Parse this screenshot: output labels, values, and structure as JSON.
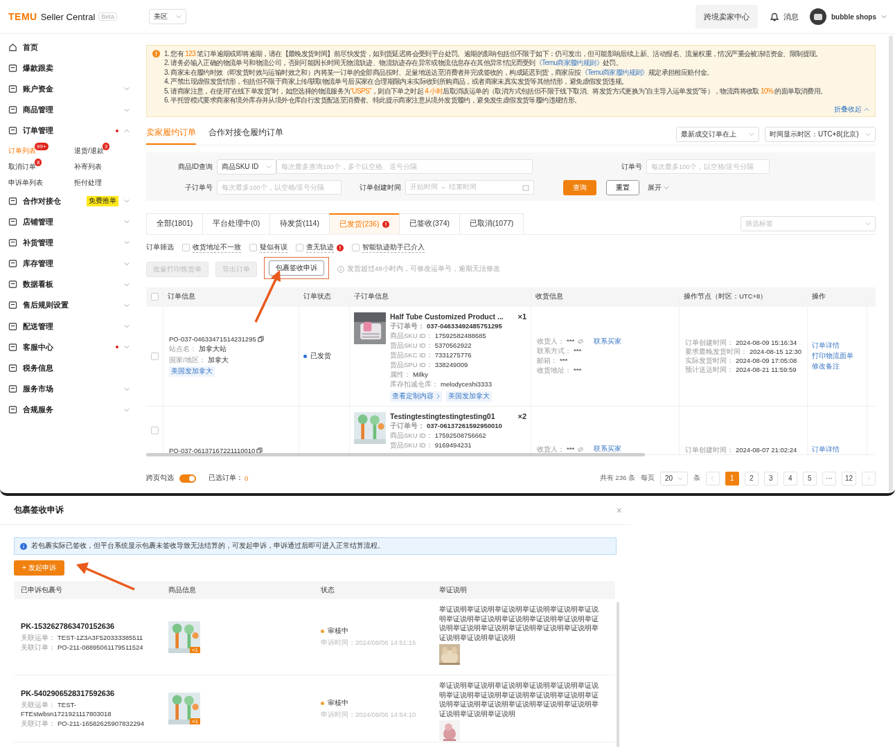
{
  "header": {
    "logo": "TEMU",
    "product": "Seller Central",
    "badge": "Beta",
    "region": "美区",
    "center_button": "跨境卖家中心",
    "messages": "消息",
    "account": "bubble shops"
  },
  "sidebar": [
    {
      "label": "首页",
      "kind": "link",
      "alert": false
    },
    {
      "label": "爆款跟卖",
      "kind": "link",
      "alert": false
    },
    {
      "label": "账户资金",
      "kind": "group",
      "expanded": false,
      "alert": false
    },
    {
      "label": "商品管理",
      "kind": "group",
      "expanded": false,
      "alert": false
    },
    {
      "label": "订单管理",
      "kind": "group",
      "expanded": true,
      "alert": true,
      "children": [
        {
          "label": "订单列表",
          "selected": true,
          "badge": "99+"
        },
        {
          "label": "退货/退款",
          "selected": false,
          "badge": "3"
        },
        {
          "label": "取消订单",
          "selected": false,
          "badge": "8"
        },
        {
          "label": "补寄列表",
          "selected": false
        },
        {
          "label": "申诉单列表",
          "selected": false
        },
        {
          "label": "拒付处理",
          "selected": false
        }
      ]
    },
    {
      "label": "合作对接仓",
      "kind": "group",
      "expanded": false,
      "alert": false,
      "tag": "免费推单"
    },
    {
      "label": "店铺管理",
      "kind": "group",
      "expanded": false,
      "alert": false
    },
    {
      "label": "补货管理",
      "kind": "group",
      "expanded": false,
      "alert": false
    },
    {
      "label": "库存管理",
      "kind": "group",
      "expanded": false,
      "alert": false
    },
    {
      "label": "数据看板",
      "kind": "group",
      "expanded": false,
      "alert": false
    },
    {
      "label": "售后规则设置",
      "kind": "group",
      "expanded": false,
      "alert": false
    },
    {
      "label": "配送管理",
      "kind": "group",
      "expanded": false,
      "alert": false
    },
    {
      "label": "客服中心",
      "kind": "group",
      "expanded": false,
      "alert": true
    },
    {
      "label": "税务信息",
      "kind": "link",
      "alert": false
    },
    {
      "label": "服务市场",
      "kind": "group",
      "expanded": false,
      "alert": false
    },
    {
      "label": "合规服务",
      "kind": "group",
      "expanded": false,
      "alert": false
    }
  ],
  "notice": {
    "lines": [
      [
        {
          "kind": "text",
          "text": "1. 您有 "
        },
        {
          "kind": "em",
          "text": "123"
        },
        {
          "kind": "text",
          "text": " 笔订单逾期或即将逾期，请在【最晚发货时间】前尽快发货，如到货延迟将会受到平台处罚。逾期的影响包括但不限于如下：仍可发出，但可能影响后续上新、活动报名、流量权重，情况严重会被冻结资金、限制提现。"
        }
      ],
      [
        {
          "kind": "text",
          "text": "2. 请务必输入正确的物流单号和物流公司，否则可能因长时间无物流轨迹、物流轨迹存在异常或物流信息存在其他异常情况而受到"
        },
        {
          "kind": "link",
          "text": "《Temu商家履约规则》"
        },
        {
          "kind": "text",
          "text": "处罚。"
        }
      ],
      [
        {
          "kind": "text",
          "text": "3. 商家未在履约时效（即发货时效与运输时效之和）内将某一订单的全部商品按时、足量地送达至消费者并完成签收的，构成延迟到货，商家应按"
        },
        {
          "kind": "link",
          "text": "《Temu商家履约规则》"
        },
        {
          "kind": "text",
          "text": "规定承担相应赔付金。"
        }
      ],
      [
        {
          "kind": "text",
          "text": "4. 严禁出现虚假发货情形，包括但不限于商家上传/获取物流单号后买家在合理期限内未实际收到所购商品，或者商家未真实发货等其他情形，避免虚假发货违规。"
        }
      ],
      [
        {
          "kind": "text",
          "text": "5. 请商家注意，在使用“在线下单发货”时，如您选择的物流服务为"
        },
        {
          "kind": "em",
          "text": "“USPS”"
        },
        {
          "kind": "text",
          "text": "，则自下单之时起 "
        },
        {
          "kind": "em",
          "text": "4 小时"
        },
        {
          "kind": "text",
          "text": "后取消该运单的（取消方式包括但不限于线下取消、将发货方式更换为“自主导入运单发货”等），物流商将收取 "
        },
        {
          "kind": "em",
          "text": "10%"
        },
        {
          "kind": "text",
          "text": " 的面单取消费用。"
        }
      ],
      [
        {
          "kind": "text",
          "text": "6. 半托管模式要求商家有境外库存并从境外仓库自行发货配送至消费者。特此提示商家注意从境外发货履约，避免发生虚假发货等履约违规情形。"
        }
      ]
    ],
    "collapse": "折叠收起"
  },
  "tabs": [
    {
      "label": "卖家履约订单",
      "selected": true
    },
    {
      "label": "合作对接仓履约订单",
      "selected": false
    }
  ],
  "sort_select": "最新成交订单在上",
  "timezone_select": "时间显示时区：UTC+8(北京)",
  "filters": {
    "id_label": "商品ID查询",
    "id_type": "商品SKU ID",
    "id_placeholder": "每次最多查询100个，多个以空格、逗号分隔",
    "order_label": "订单号",
    "order_placeholder": "每次最多100个，以空格/逗号分隔",
    "sub_label": "子订单号",
    "sub_placeholder": "每次最多100个，以空格/逗号分隔",
    "time_label": "订单创建时间",
    "start_placeholder": "开始时间",
    "range_separator": "~",
    "end_placeholder": "结束时间",
    "search": "查询",
    "reset": "重置",
    "expand": "展开"
  },
  "status_tabs": [
    {
      "label": "全部(1801)",
      "selected": false,
      "alert": false
    },
    {
      "label": "平台处理中(0)",
      "selected": false,
      "alert": false
    },
    {
      "label": "待发货(114)",
      "selected": false,
      "alert": false
    },
    {
      "label": "已发货(236)",
      "selected": true,
      "alert": true
    },
    {
      "label": "已签收(374)",
      "selected": false,
      "alert": false
    },
    {
      "label": "已取消(1077)",
      "selected": false,
      "alert": false
    }
  ],
  "tag_select": {
    "placeholder": "筛选标签"
  },
  "order_filter": {
    "label": "订单筛选",
    "options": [
      {
        "label": "收货地址不一致",
        "checked": false,
        "alert": false
      },
      {
        "label": "疑似有误",
        "checked": false,
        "alert": false
      },
      {
        "label": "查无轨迹",
        "checked": false,
        "alert": true
      },
      {
        "label": "智能轨迹助手已介入",
        "checked": false,
        "alert": false
      }
    ]
  },
  "actions": [
    {
      "label": "批量打印拣货单",
      "disabled": true,
      "highlighted": false
    },
    {
      "label": "导出订单",
      "disabled": true,
      "highlighted": false
    },
    {
      "label": "包裹签收申诉",
      "disabled": false,
      "highlighted": true
    }
  ],
  "action_hint": "发货超过48小时内，可修改运单号，逾期无法修改",
  "table": {
    "all_checked": false,
    "columns": [
      "订单信息",
      "订单状态",
      "子订单信息",
      "收货信息",
      "操作节点（时区：UTC+8）",
      "操作"
    ],
    "rows": [
      {
        "checked": false,
        "order_no": "PO-037-04633471514231295",
        "site": [
          "站点名：",
          "加拿大站"
        ],
        "country": [
          "国家/地区：",
          "加拿大"
        ],
        "tag": "美国发加拿大",
        "status": "已发货",
        "product": {
          "title": "Half Tube Customized Product ...",
          "qty": "×1",
          "fields": [
            [
              "子订单号：",
              "037-04633492485751295"
            ],
            [
              "商品SKU ID：",
              "17592582488685"
            ],
            [
              "货品SKU ID：",
              "5370562922"
            ],
            [
              "货品SKC ID：",
              "7331275776"
            ],
            [
              "货品SPU ID：",
              "338249009"
            ],
            [
              "属性：",
              "Milky"
            ],
            [
              "库存扣减仓库：",
              "melodyceshi3333"
            ]
          ],
          "link": "查看定制内容",
          "tag": "美国发加拿大"
        },
        "receiver": [
          [
            "收货人：",
            "***"
          ],
          [
            "联系方式：",
            "***"
          ],
          [
            "邮箱：",
            "***"
          ],
          [
            "收货地址：",
            "***"
          ]
        ],
        "contact": "联系买家",
        "times": [
          [
            "订单创建时间：",
            "2024-08-09 15:16:34"
          ],
          [
            "要求最晚发货时间：",
            "2024-08-15 12:30"
          ],
          [
            "实际发货时间：",
            "2024-08-09 17:05:08"
          ],
          [
            "预计送达时间：",
            "2024-08-21 11:59:59"
          ]
        ],
        "ops": [
          "订单详情",
          "打印物流面单",
          "修改备注"
        ]
      },
      {
        "checked": false,
        "order_no": "PO-037-06137167221110010",
        "product": {
          "title": "Testingtestingtestingtesting01",
          "qty": "×2",
          "fields": [
            [
              "子订单号：",
              "037-06137261592950010"
            ],
            [
              "商品SKU ID：",
              "17592508756662"
            ],
            [
              "货品SKU ID：",
              "9169494231"
            ]
          ]
        },
        "receiver": [
          [
            "收货人：",
            "***"
          ]
        ],
        "contact": "联系买家",
        "times": [
          [
            "订单创建时间：",
            "2024-08-07 21:02:24"
          ]
        ],
        "ops": [
          "订单详情"
        ]
      }
    ]
  },
  "footer": {
    "cross_page_label": "跨页勾选",
    "cross_page_on": true,
    "selected_label": "已选订单：",
    "selected_count": "0",
    "total": "共有 236 条",
    "per_page_label": "每页",
    "per_page": "20",
    "unit": "条",
    "pages": [
      {
        "label": "1",
        "selected": true
      },
      {
        "label": "2",
        "selected": false
      },
      {
        "label": "3",
        "selected": false
      },
      {
        "label": "4",
        "selected": false
      },
      {
        "label": "5",
        "selected": false
      },
      {
        "label": "···",
        "selected": false
      },
      {
        "label": "12",
        "selected": false
      }
    ]
  },
  "dialog": {
    "title": "包裹签收申诉",
    "close": "×",
    "info": "若包裹实际已签收，但平台系统显示包裹未签收导致无法结算的，可发起申诉，申诉通过后即可进入正常结算流程。",
    "add_button": "+ 发起申诉",
    "columns": [
      "已申诉包裹号",
      "商品信息",
      "状态",
      "举证说明"
    ],
    "rows": [
      {
        "package_no": "PK-1532627863470152636",
        "waybill": [
          "关联运单：",
          "TEST-1Z3A3F520333385511"
        ],
        "order": [
          "关联订单：",
          "PO-211-08895061179511524"
        ],
        "qty": "×1",
        "status": "审核中",
        "time": [
          "申诉时间：",
          "2024/08/06 14:51:15"
        ],
        "evidence": "举证说明举证说明举证说明举证说明举证说明举证说明举证说明举证说明举证说明举证说明举证说明举证说明举证说明举证说明举证说明举证说明举证说明举证说明举证说明举证说明"
      },
      {
        "package_no": "PK-5402906528317592636",
        "waybill": [
          "关联运单：",
          "TEST-FTEstwbsn1721921117803018"
        ],
        "order": [
          "关联订单：",
          "PO-211-16582625907832294"
        ],
        "qty": "×1",
        "status": "审核中",
        "time": [
          "申诉时间：",
          "2024/08/06 14:54:10"
        ],
        "evidence": "举证说明举证说明举证说明举证说明举证说明举证说明举证说明举证说明举证说明举证说明举证说明举证说明举证说明举证说明举证说明举证说明举证说明举证说明举证说明举证说明"
      }
    ]
  }
}
